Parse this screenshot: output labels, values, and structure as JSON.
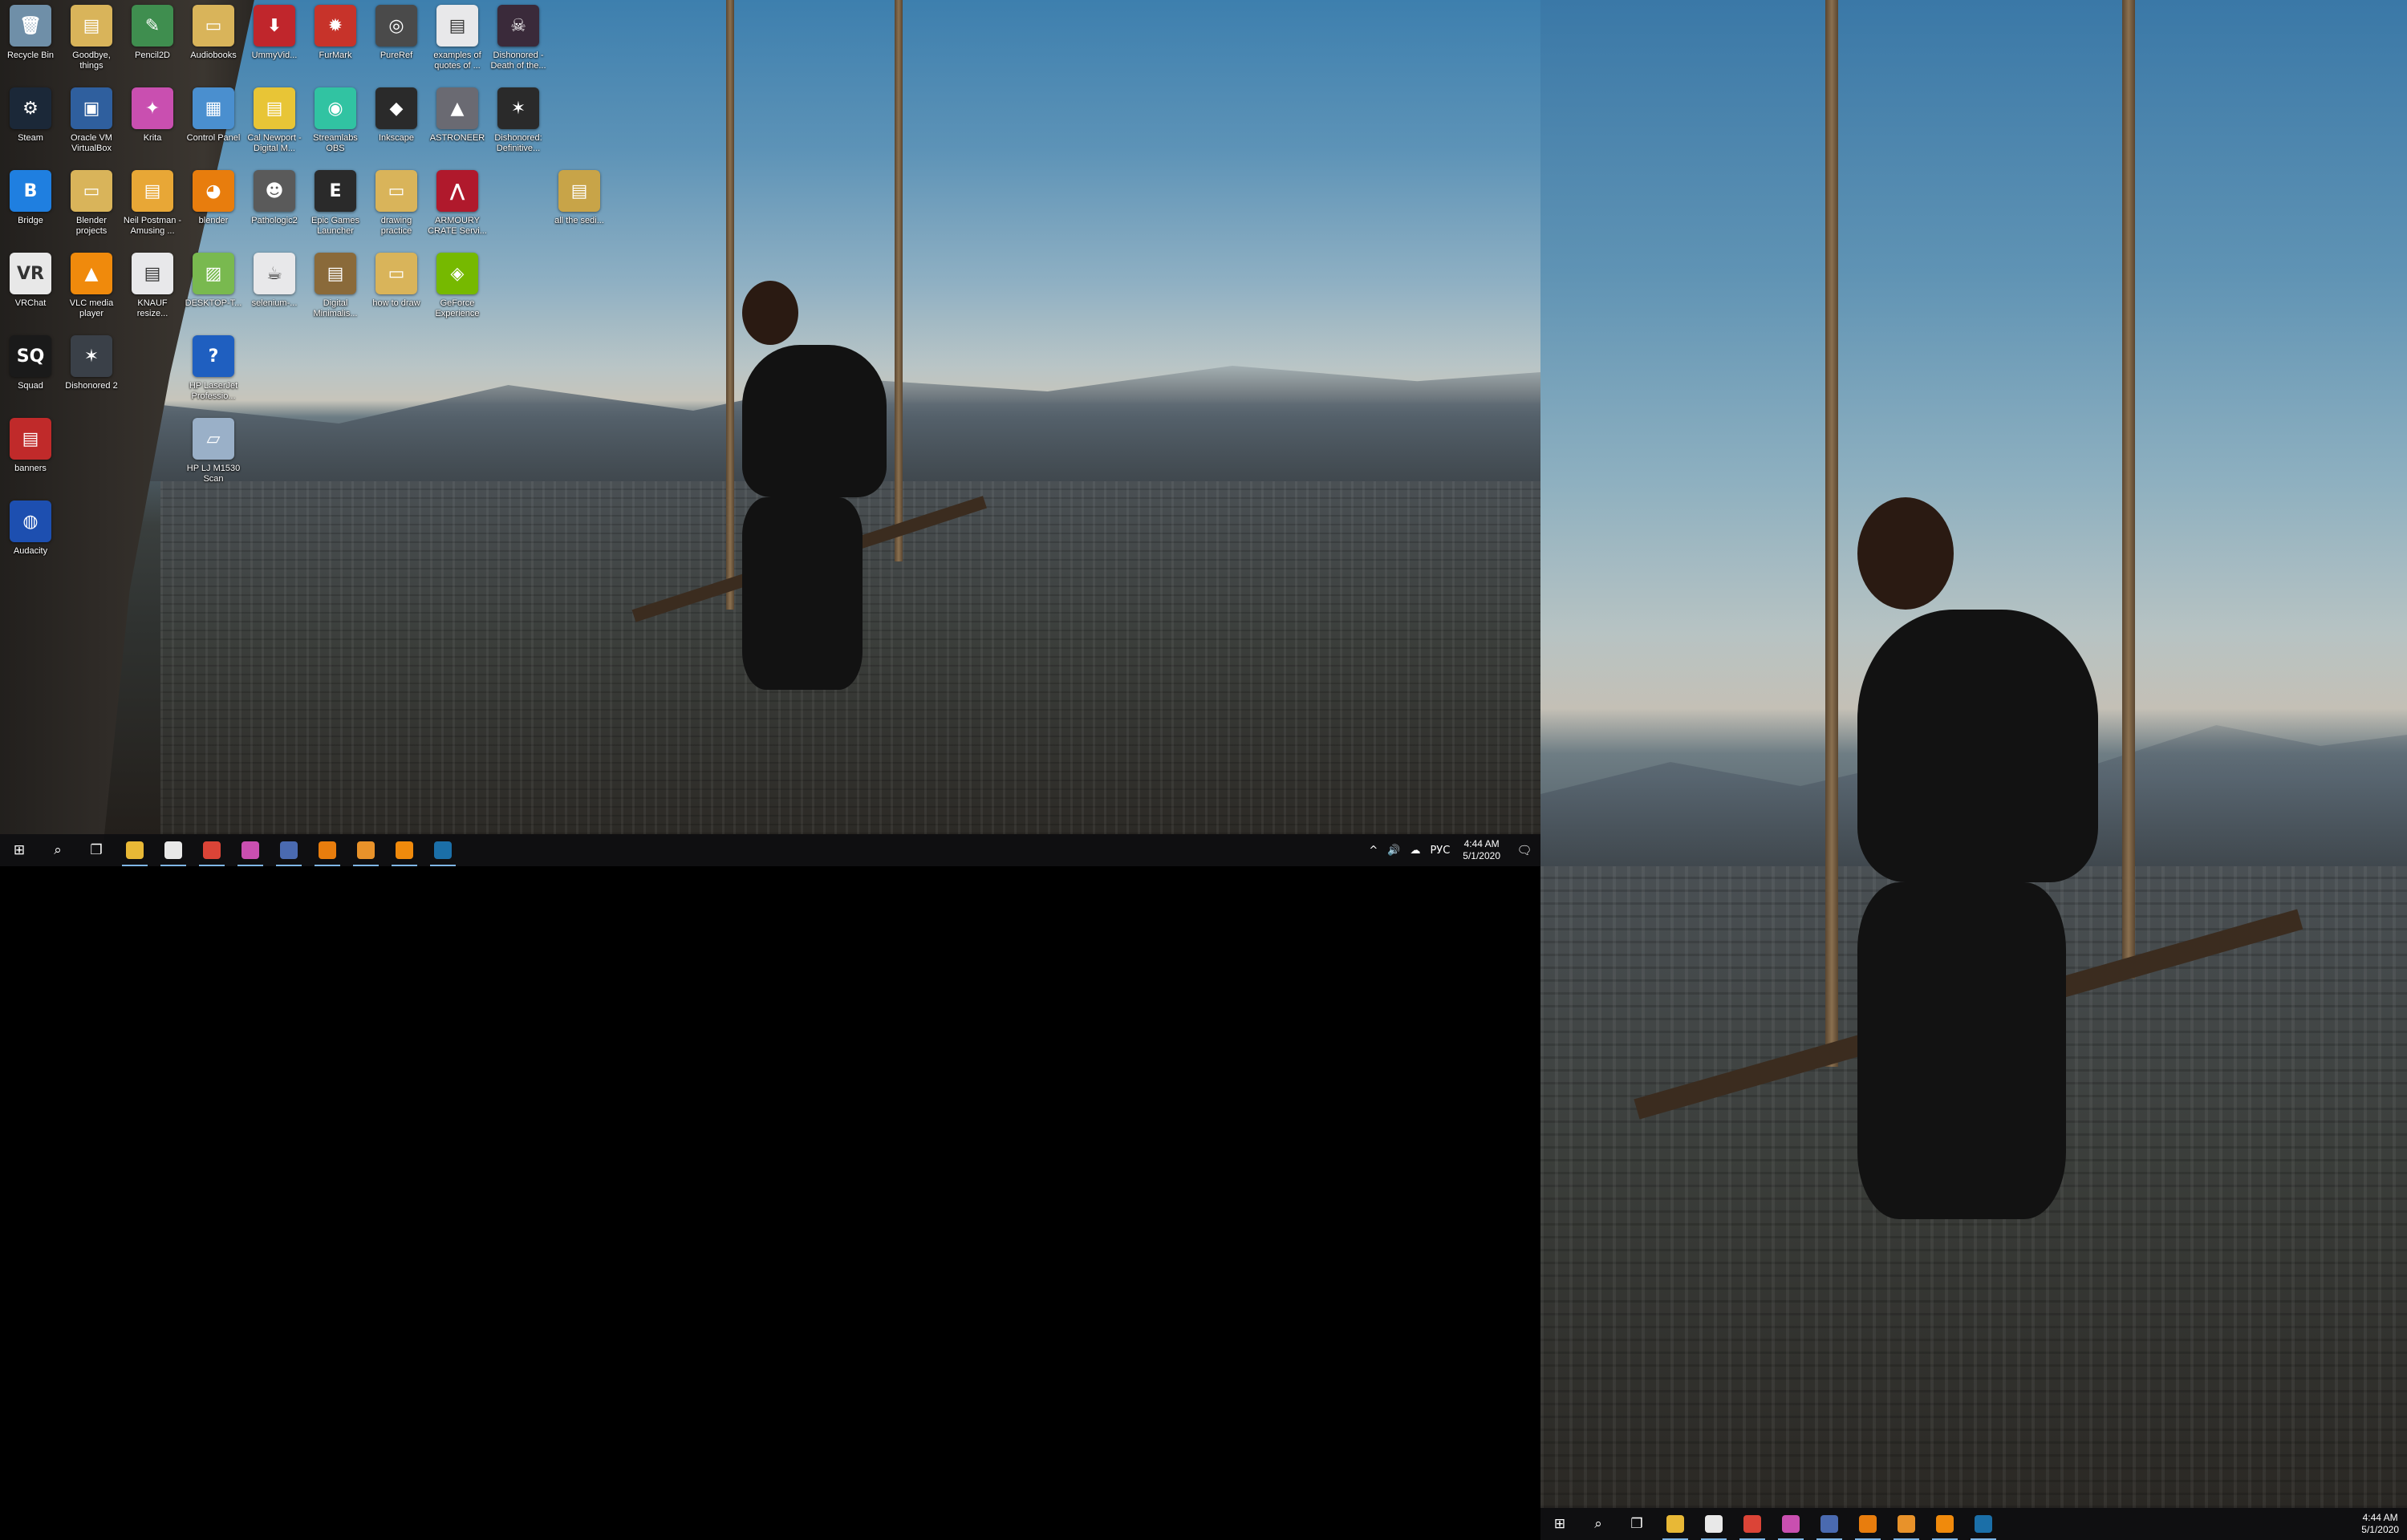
{
  "desktop": {
    "icons": [
      {
        "label": "Recycle Bin",
        "glyph": "🗑",
        "color": "#6f8fa8"
      },
      {
        "label": "Goodbye, things",
        "glyph": "▤",
        "color": "#d9b45a"
      },
      {
        "label": "Pencil2D",
        "glyph": "✎",
        "color": "#3f8e4f"
      },
      {
        "label": "Audiobooks",
        "glyph": "▭",
        "color": "#d9b45a"
      },
      {
        "label": "UmmyVid...",
        "glyph": "⬇",
        "color": "#c0262c"
      },
      {
        "label": "FurMark",
        "glyph": "✹",
        "color": "#c7332a"
      },
      {
        "label": "PureRef",
        "glyph": "◎",
        "color": "#4a4a4a"
      },
      {
        "label": "examples of quotes of ...",
        "glyph": "▤",
        "color": "#e8e8ea"
      },
      {
        "label": "Dishonored - Death of the...",
        "glyph": "☠",
        "color": "#3a2a3a"
      },
      {
        "label": "Steam",
        "glyph": "⚙",
        "color": "#1b2838"
      },
      {
        "label": "Oracle VM VirtualBox",
        "glyph": "▣",
        "color": "#2f5f9e"
      },
      {
        "label": "Krita",
        "glyph": "✦",
        "color": "#c94fb0"
      },
      {
        "label": "Control Panel",
        "glyph": "▦",
        "color": "#4a8fcf"
      },
      {
        "label": "Cal Newport - Digital M...",
        "glyph": "▤",
        "color": "#e8c536"
      },
      {
        "label": "Streamlabs OBS",
        "glyph": "◉",
        "color": "#31c3a2"
      },
      {
        "label": "Inkscape",
        "glyph": "◆",
        "color": "#2a2a2a"
      },
      {
        "label": "ASTRONEER",
        "glyph": "▲",
        "color": "#6a6a72"
      },
      {
        "label": "Dishonored: Definitive...",
        "glyph": "✶",
        "color": "#2a2a2a"
      },
      {
        "label": "Bridge",
        "glyph": "B",
        "color": "#1f7fe0"
      },
      {
        "label": "Blender projects",
        "glyph": "▭",
        "color": "#d9b45a"
      },
      {
        "label": "Neil Postman - Amusing ...",
        "glyph": "▤",
        "color": "#e8a736"
      },
      {
        "label": "blender",
        "glyph": "◕",
        "color": "#e87d0d"
      },
      {
        "label": "Pathologic2",
        "glyph": "☻",
        "color": "#5a5a5a"
      },
      {
        "label": "Epic Games Launcher",
        "glyph": "E",
        "color": "#2a2a2a"
      },
      {
        "label": "drawing practice",
        "glyph": "▭",
        "color": "#d9b45a"
      },
      {
        "label": "ARMOURY CRATE Servi...",
        "glyph": "⋀",
        "color": "#b0192c"
      },
      {
        "label": "all the sedi...",
        "glyph": "▤",
        "color": "#c8a448"
      },
      {
        "label": "VRChat",
        "glyph": "VR",
        "color": "#e8e8e8"
      },
      {
        "label": "VLC media player",
        "glyph": "▲",
        "color": "#f08a0c"
      },
      {
        "label": "KNAUF resize...",
        "glyph": "▤",
        "color": "#e8e8ea"
      },
      {
        "label": "DESKTOP-T...",
        "glyph": "▨",
        "color": "#79b94f"
      },
      {
        "label": "selenium-...",
        "glyph": "☕",
        "color": "#e8e8ea"
      },
      {
        "label": "Digital Minimalis...",
        "glyph": "▤",
        "color": "#8a6a3a"
      },
      {
        "label": "how to draw",
        "glyph": "▭",
        "color": "#d9b45a"
      },
      {
        "label": "GeForce Experience",
        "glyph": "◈",
        "color": "#76b900"
      },
      {
        "label": "Squad",
        "glyph": "SQ",
        "color": "#1a1a1a"
      },
      {
        "label": "Dishonored 2",
        "glyph": "✶",
        "color": "#3a4048"
      },
      {
        "label": "HP LaserJet Professio...",
        "glyph": "?",
        "color": "#1f5fc0"
      },
      {
        "label": "banners",
        "glyph": "▤",
        "color": "#c02a2a"
      },
      {
        "label": "HP LJ M1530 Scan",
        "glyph": "▱",
        "color": "#9ab0c8"
      },
      {
        "label": "Audacity",
        "glyph": "◍",
        "color": "#1d4fb0"
      }
    ]
  },
  "taskbar": {
    "start_glyph": "⊞",
    "search_glyph": "⌕",
    "taskview_glyph": "❐",
    "apps": [
      {
        "name": "file-explorer",
        "color": "#e8b836"
      },
      {
        "name": "info-app",
        "color": "#e8e8e8"
      },
      {
        "name": "chrome",
        "color": "#db4437"
      },
      {
        "name": "krita",
        "color": "#c94fb0"
      },
      {
        "name": "app-blue",
        "color": "#4a6ab0"
      },
      {
        "name": "blender",
        "color": "#e87d0d"
      },
      {
        "name": "pathologic-orange",
        "color": "#e8922a"
      },
      {
        "name": "vlc",
        "color": "#f08a0c"
      },
      {
        "name": "steam",
        "color": "#1b6fa8"
      }
    ],
    "tray_chevron": "^",
    "tray_volume": "🔊",
    "tray_cloud": "☁",
    "language": "РУС",
    "time": "4:44 AM",
    "date": "5/1/2020",
    "notification_glyph": "🗨"
  },
  "taskbar_right": {
    "time": "4:44 AM",
    "date": "5/1/2020"
  }
}
